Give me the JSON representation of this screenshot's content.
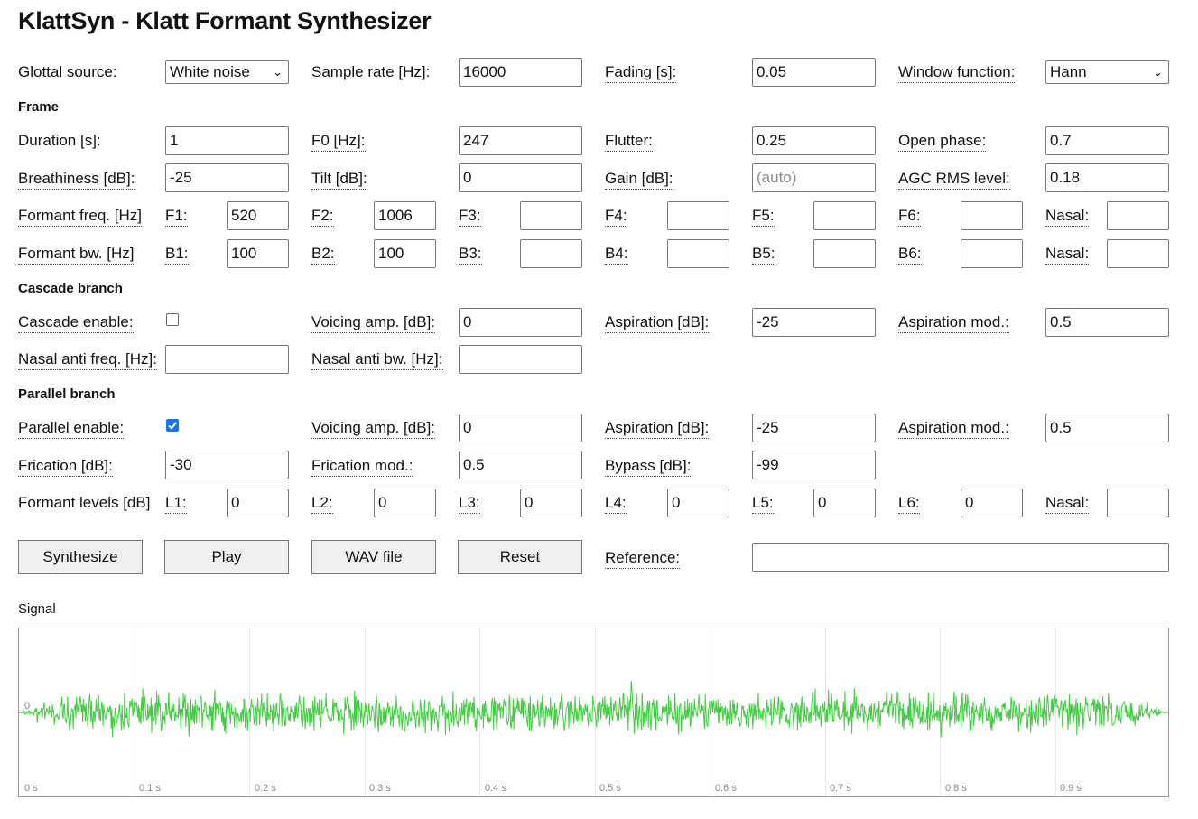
{
  "title": "KlattSyn - Klatt Formant Synthesizer",
  "global": {
    "glottal_source_label": "Glottal source:",
    "glottal_source_value": "White noise",
    "sample_rate_label": "Sample rate [Hz]:",
    "sample_rate_value": "16000",
    "fading_label": "Fading [s]:",
    "fading_value": "0.05",
    "window_function_label": "Window function:",
    "window_function_value": "Hann"
  },
  "frame": {
    "heading": "Frame",
    "duration_label": "Duration [s]:",
    "duration_value": "1",
    "f0_label": "F0 [Hz]:",
    "f0_value": "247",
    "flutter_label": "Flutter:",
    "flutter_value": "0.25",
    "open_phase_label": "Open phase:",
    "open_phase_value": "0.7",
    "breathiness_label": "Breathiness [dB]:",
    "breathiness_value": "-25",
    "tilt_label": "Tilt [dB]:",
    "tilt_value": "0",
    "gain_label": "Gain [dB]:",
    "gain_value": "",
    "gain_placeholder": "(auto)",
    "agc_label": "AGC RMS level:",
    "agc_value": "0.18",
    "formant_freq_label": "Formant freq. [Hz]",
    "formant_freqs": [
      {
        "label": "F1:",
        "value": "520"
      },
      {
        "label": "F2:",
        "value": "1006"
      },
      {
        "label": "F3:",
        "value": ""
      },
      {
        "label": "F4:",
        "value": ""
      },
      {
        "label": "F5:",
        "value": ""
      },
      {
        "label": "F6:",
        "value": ""
      },
      {
        "label": "Nasal:",
        "value": ""
      }
    ],
    "formant_bw_label": "Formant bw. [Hz]",
    "formant_bws": [
      {
        "label": "B1:",
        "value": "100"
      },
      {
        "label": "B2:",
        "value": "100"
      },
      {
        "label": "B3:",
        "value": ""
      },
      {
        "label": "B4:",
        "value": ""
      },
      {
        "label": "B5:",
        "value": ""
      },
      {
        "label": "B6:",
        "value": ""
      },
      {
        "label": "Nasal:",
        "value": ""
      }
    ]
  },
  "cascade": {
    "heading": "Cascade branch",
    "enable_label": "Cascade enable:",
    "enabled": false,
    "voicing_amp_label": "Voicing amp. [dB]:",
    "voicing_amp_value": "0",
    "aspiration_label": "Aspiration [dB]:",
    "aspiration_value": "-25",
    "aspiration_mod_label": "Aspiration mod.:",
    "aspiration_mod_value": "0.5",
    "nasal_anti_freq_label": "Nasal anti freq. [Hz]:",
    "nasal_anti_freq_value": "",
    "nasal_anti_bw_label": "Nasal anti bw. [Hz]:",
    "nasal_anti_bw_value": ""
  },
  "parallel": {
    "heading": "Parallel branch",
    "enable_label": "Parallel enable:",
    "enabled": true,
    "voicing_amp_label": "Voicing amp. [dB]:",
    "voicing_amp_value": "0",
    "aspiration_label": "Aspiration [dB]:",
    "aspiration_value": "-25",
    "aspiration_mod_label": "Aspiration mod.:",
    "aspiration_mod_value": "0.5",
    "frication_label": "Frication [dB]:",
    "frication_value": "-30",
    "frication_mod_label": "Frication mod.:",
    "frication_mod_value": "0.5",
    "bypass_label": "Bypass [dB]:",
    "bypass_value": "-99",
    "formant_levels_label": "Formant levels [dB]",
    "levels": [
      {
        "label": "L1:",
        "value": "0"
      },
      {
        "label": "L2:",
        "value": "0"
      },
      {
        "label": "L3:",
        "value": "0"
      },
      {
        "label": "L4:",
        "value": "0"
      },
      {
        "label": "L5:",
        "value": "0"
      },
      {
        "label": "L6:",
        "value": "0"
      },
      {
        "label": "Nasal:",
        "value": ""
      }
    ]
  },
  "buttons": {
    "synthesize": "Synthesize",
    "play": "Play",
    "wav_file": "WAV file",
    "reset": "Reset"
  },
  "reference_label": "Reference:",
  "reference_value": "",
  "signal": {
    "heading": "Signal",
    "zero_label": "0",
    "color": "#44cc44",
    "time_labels": [
      "0 s",
      "0.1 s",
      "0.2 s",
      "0.3 s",
      "0.4 s",
      "0.5 s",
      "0.6 s",
      "0.7 s",
      "0.8 s",
      "0.9 s"
    ]
  }
}
